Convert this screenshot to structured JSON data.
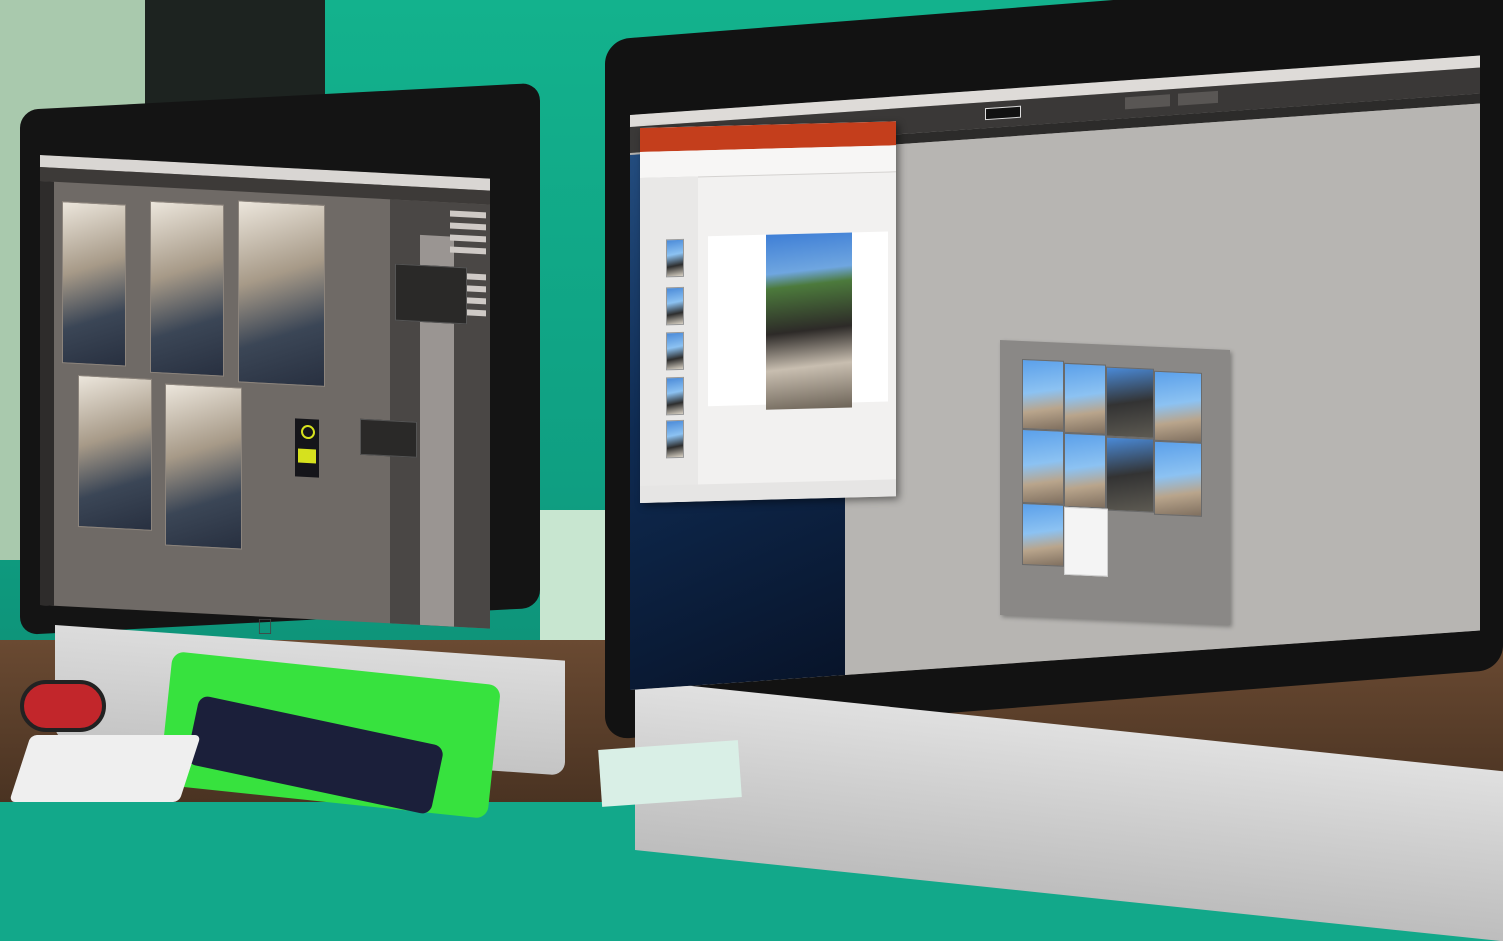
{
  "scene": {
    "description_free": true,
    "colors": {
      "wall": "#13b28d",
      "desk": "#5b3f2b",
      "mousepad": "#37e23e",
      "app_accent_powerpoint": "#c43e1c",
      "logo_yellow": "#d6e11e"
    }
  },
  "icons": {
    "apple": "apple-logo-icon"
  },
  "left_monitor": {
    "photos_top_row": 3,
    "photos_bottom_row": 2
  },
  "right_monitor": {
    "powerpoint_thumbnails": 5,
    "indesign_grid_photos": 9
  }
}
